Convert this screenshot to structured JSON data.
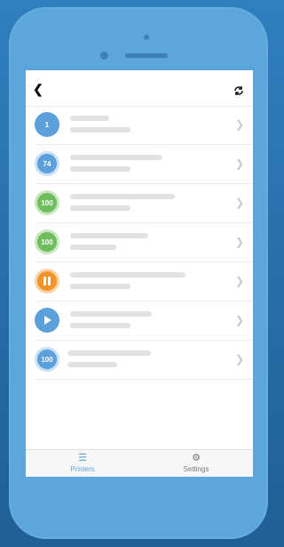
{
  "colors": {
    "accent": "#5b9fdb",
    "green": "#6fbe5d",
    "orange": "#f0932b"
  },
  "nav": {
    "back_icon": "chevron-left-icon",
    "refresh_icon": "refresh-icon"
  },
  "rows": [
    {
      "badge": "1",
      "status": "queued",
      "icon": "queue-icon"
    },
    {
      "badge": "74",
      "status": "printing",
      "icon": "progress-icon",
      "progress": 0.74
    },
    {
      "badge": "100",
      "status": "done",
      "icon": "done-icon",
      "progress": 1.0
    },
    {
      "badge": "100",
      "status": "done",
      "icon": "done-icon",
      "progress": 1.0
    },
    {
      "badge": "",
      "status": "paused",
      "icon": "pause-icon"
    },
    {
      "badge": "",
      "status": "ready",
      "icon": "play-icon"
    },
    {
      "badge": "100",
      "status": "done",
      "icon": "done-icon",
      "progress": 1.0
    }
  ],
  "tabs": [
    {
      "label": "Printers",
      "icon": "printers-icon"
    },
    {
      "label": "Settings",
      "icon": "gear-icon"
    }
  ]
}
